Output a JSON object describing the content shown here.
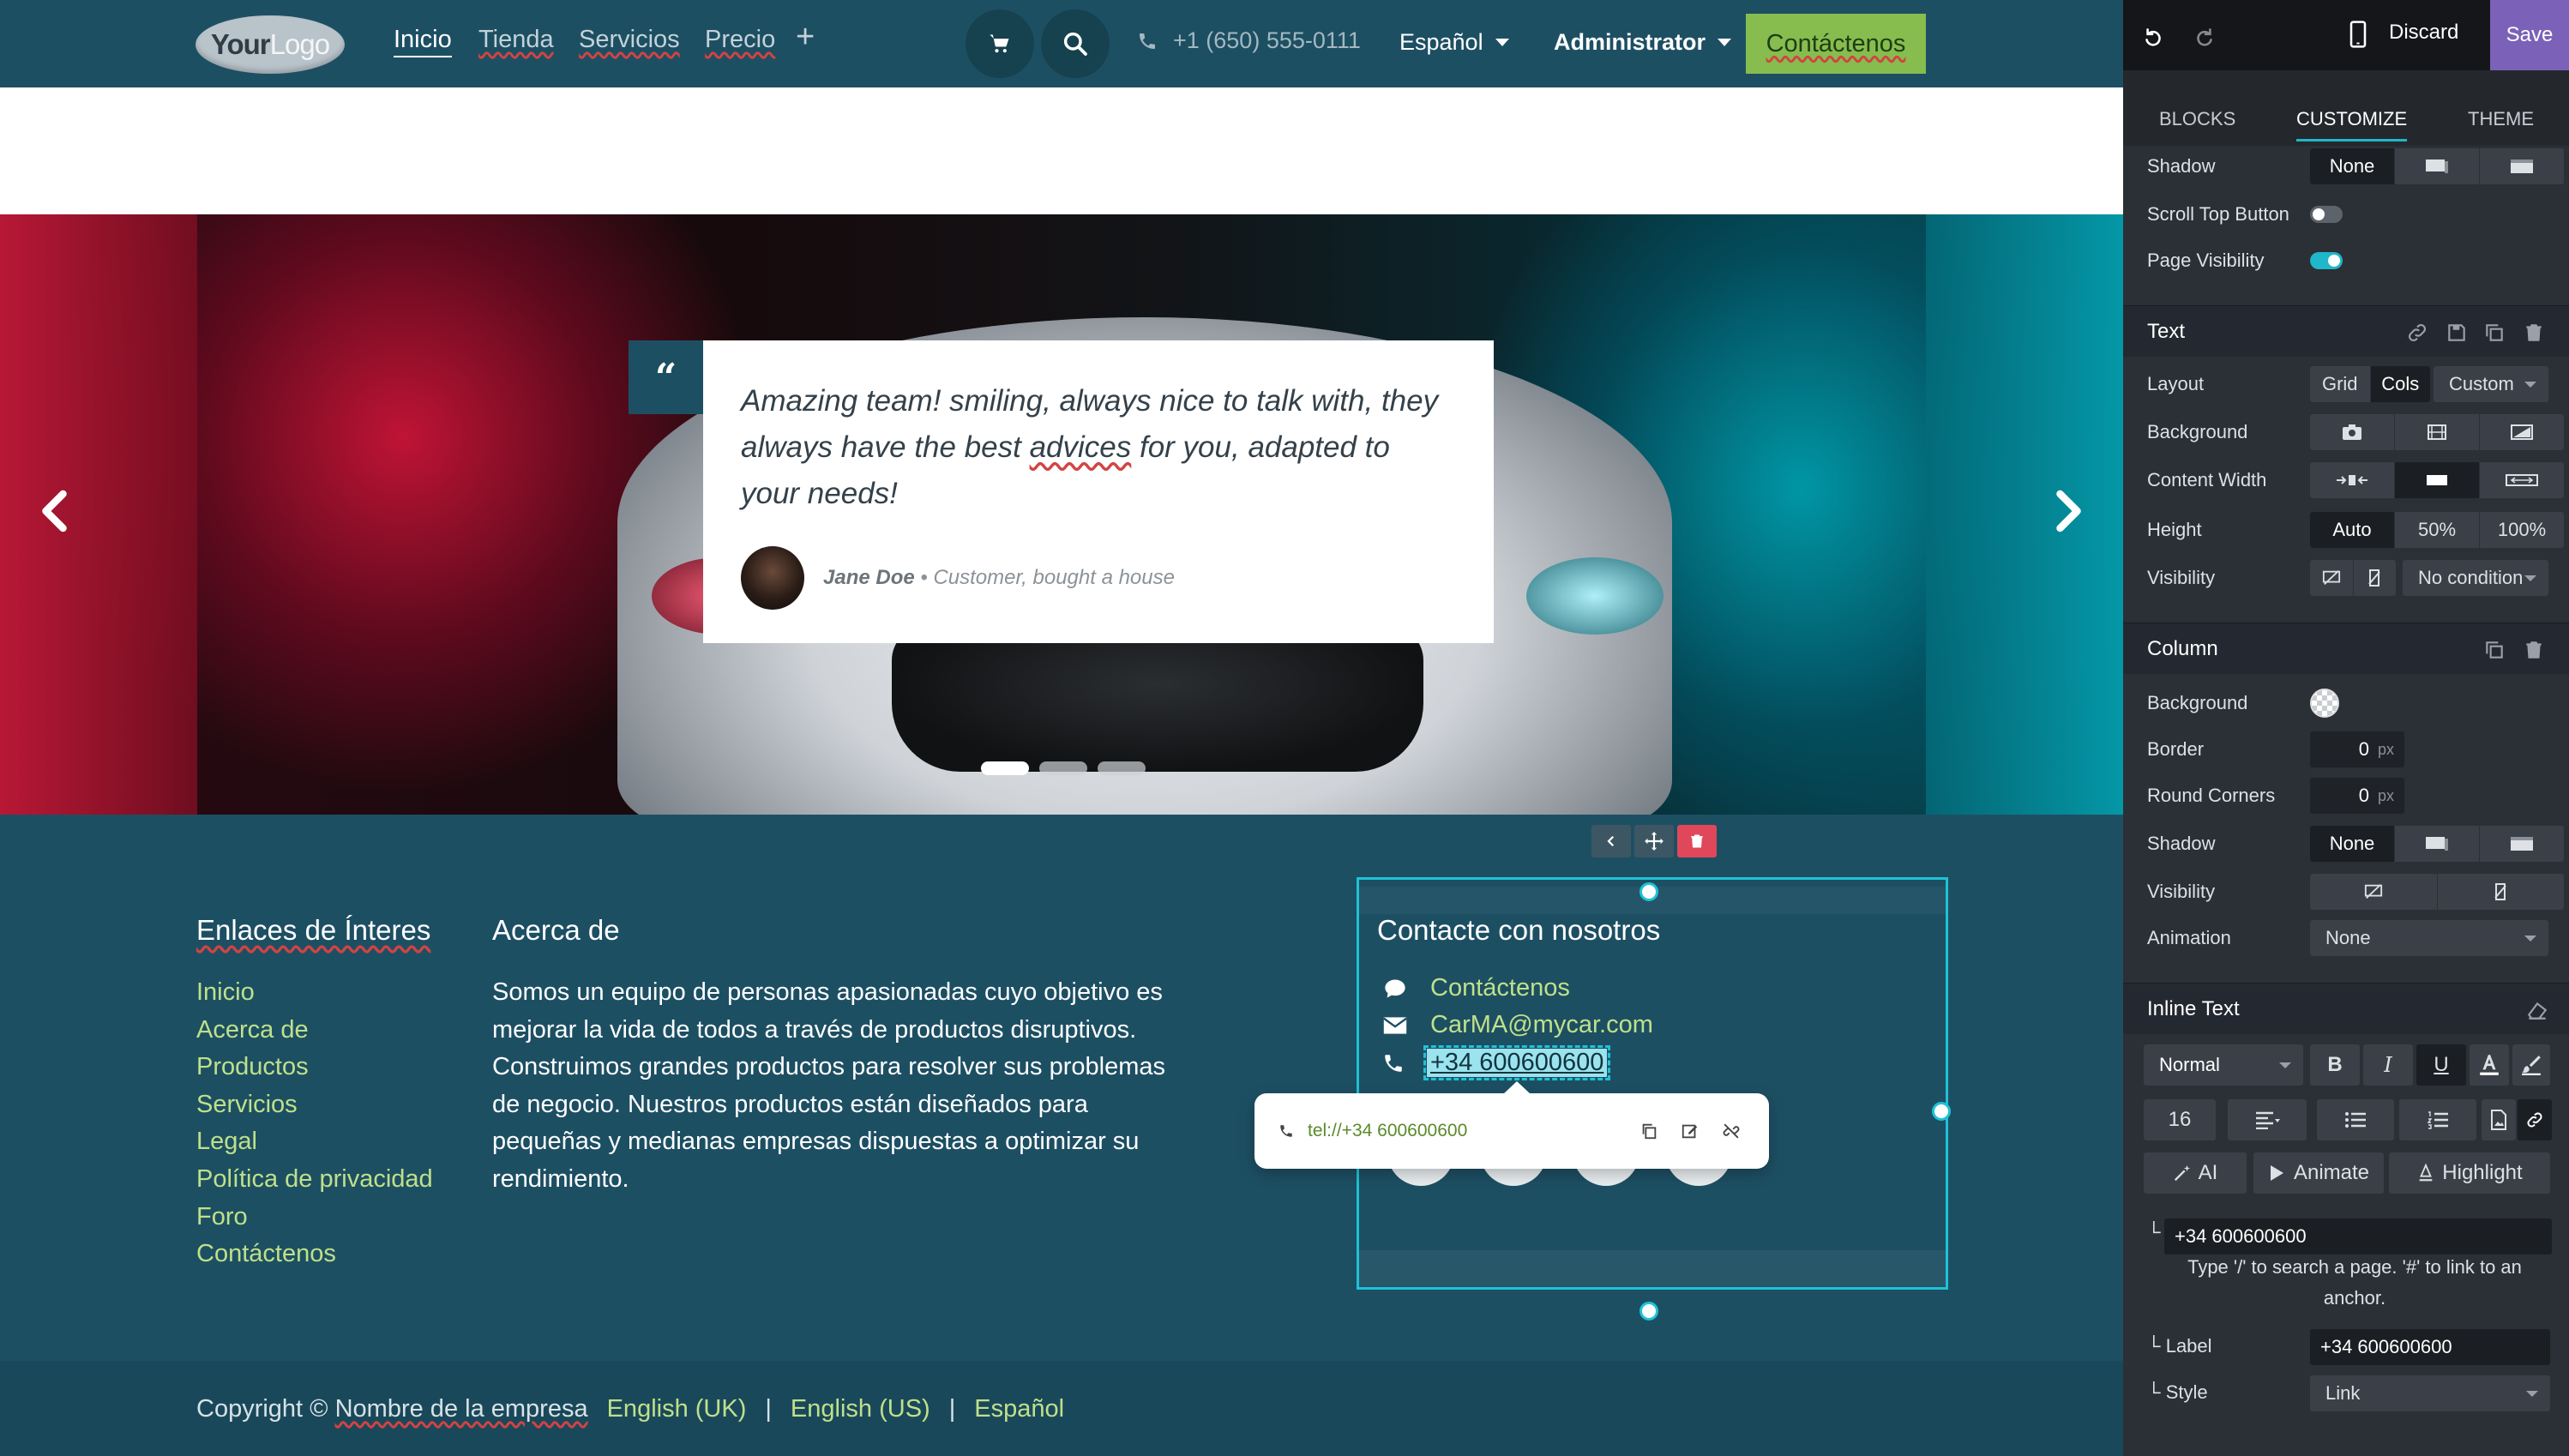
{
  "navbar": {
    "logo_text_bold": "Your",
    "logo_text_light": "Logo",
    "links": [
      {
        "label": "Inicio",
        "active": true
      },
      {
        "label": "Tienda"
      },
      {
        "label": "Servicios"
      },
      {
        "label": "Precio"
      }
    ],
    "phone": "+1 (650) 555-0111",
    "language": "Español",
    "user": "Administrator",
    "cta": "Contáctenos"
  },
  "hero": {
    "quote_before": "Amazing team! smiling, always nice to talk with, they always have the best ",
    "quote_misspelled": "advices",
    "quote_after": " for you, adapted to your needs!",
    "author": "Jane Doe",
    "author_role": " • Customer, bought a house",
    "slide_count": 3,
    "active_slide": 1,
    "colors": {
      "left_accent": "#d11a3c",
      "right_accent": "#04a5b5"
    }
  },
  "footer": {
    "links_title": "Enlaces de Ínteres",
    "links": [
      "Inicio",
      "Acerca de",
      "Productos",
      "Servicios",
      "Legal",
      "Política de privacidad",
      "Foro",
      "Contáctenos"
    ],
    "about_title": "Acerca de",
    "about_text": "Somos un equipo de personas apasionadas cuyo objetivo es mejorar la vida de todos a través de productos disruptivos. Construimos grandes productos para resolver sus problemas de negocio. Nuestros productos están diseñados para pequeñas y medianas empresas dispuestas a optimizar su rendimiento.",
    "contact_title": "Contacte con nosotros",
    "contact_link": "Contáctenos",
    "email": "CarMA@mycar.com",
    "phone": "+34 600600600",
    "link_popover_url": "tel://+34 600600600"
  },
  "copyright": {
    "text_prefix": "Copyright © ",
    "company": "Nombre de la empresa",
    "languages": [
      "English (UK)",
      "English (US)",
      "Español"
    ],
    "separator": "|"
  },
  "editor": {
    "discard": "Discard",
    "save": "Save",
    "tabs": [
      {
        "label": "BLOCKS"
      },
      {
        "label": "CUSTOMIZE",
        "active": true
      },
      {
        "label": "THEME"
      }
    ],
    "top_rows": {
      "shadow_label": "Shadow",
      "shadow_value": "None",
      "scroll_top_label": "Scroll Top Button",
      "scroll_top_on": false,
      "page_visibility_label": "Page Visibility",
      "page_visibility_on": true
    },
    "text_section": {
      "title": "Text",
      "layout_label": "Layout",
      "layout_options": [
        "Grid",
        "Cols",
        "Custom"
      ],
      "layout_active": "Cols",
      "background_label": "Background",
      "content_width_label": "Content Width",
      "height_label": "Height",
      "height_options": [
        "Auto",
        "50%",
        "100%"
      ],
      "height_active": "Auto",
      "visibility_label": "Visibility",
      "visibility_value": "No condition"
    },
    "column_section": {
      "title": "Column",
      "background_label": "Background",
      "border_label": "Border",
      "border_value": "0",
      "round_label": "Round Corners",
      "round_value": "0",
      "unit": "px",
      "shadow_label": "Shadow",
      "shadow_value": "None",
      "visibility_label": "Visibility",
      "animation_label": "Animation",
      "animation_value": "None"
    },
    "inline_section": {
      "title": "Inline Text",
      "style_value": "Normal",
      "bold": "B",
      "italic": "I",
      "underline": "U",
      "font_size": "16",
      "ai_label": "AI",
      "animate_label": "Animate",
      "highlight_label": "Highlight",
      "url_value": "+34 600600600",
      "hint": "Type '/' to search a page. '#' to link to an anchor.",
      "label_label": "Label",
      "label_value": "+34 600600600",
      "style_label": "Style",
      "style_link_value": "Link"
    }
  }
}
